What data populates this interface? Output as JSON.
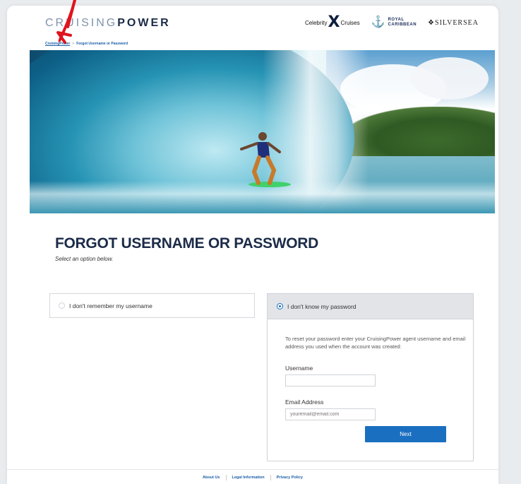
{
  "header": {
    "logo_part1": "CRUISING",
    "logo_part2": "POWER",
    "brands": {
      "celebrity_left": "Celebrity",
      "celebrity_x": "X",
      "celebrity_right": "Cruises",
      "royal_line1": "ROYAL",
      "royal_line2": "CARIBBEAN",
      "silversea": "SILVERSEA"
    }
  },
  "breadcrumb": {
    "home": "CruisingPower",
    "separator": ">",
    "current": "Forgot Username or Password"
  },
  "main": {
    "title": "FORGOT USERNAME OR PASSWORD",
    "subtitle": "Select an option below."
  },
  "options": {
    "username_option": "I don't remember my username",
    "password_option": "I don't know my password"
  },
  "panel": {
    "instructions": "To reset your password enter your CruisingPower agent username and email address you used when the account was created:",
    "username_label": "Username",
    "username_value": "",
    "email_label": "Email Address",
    "email_placeholder": "youremail@email.com",
    "next_label": "Next"
  },
  "footer": {
    "about": "About Us",
    "legal": "Legal Information",
    "privacy": "Privacy Policy"
  },
  "colors": {
    "brand_navy": "#1b2b48",
    "link_blue": "#1a5ca8",
    "button_blue": "#1b6fc0",
    "annotation_red": "#e0141e"
  }
}
